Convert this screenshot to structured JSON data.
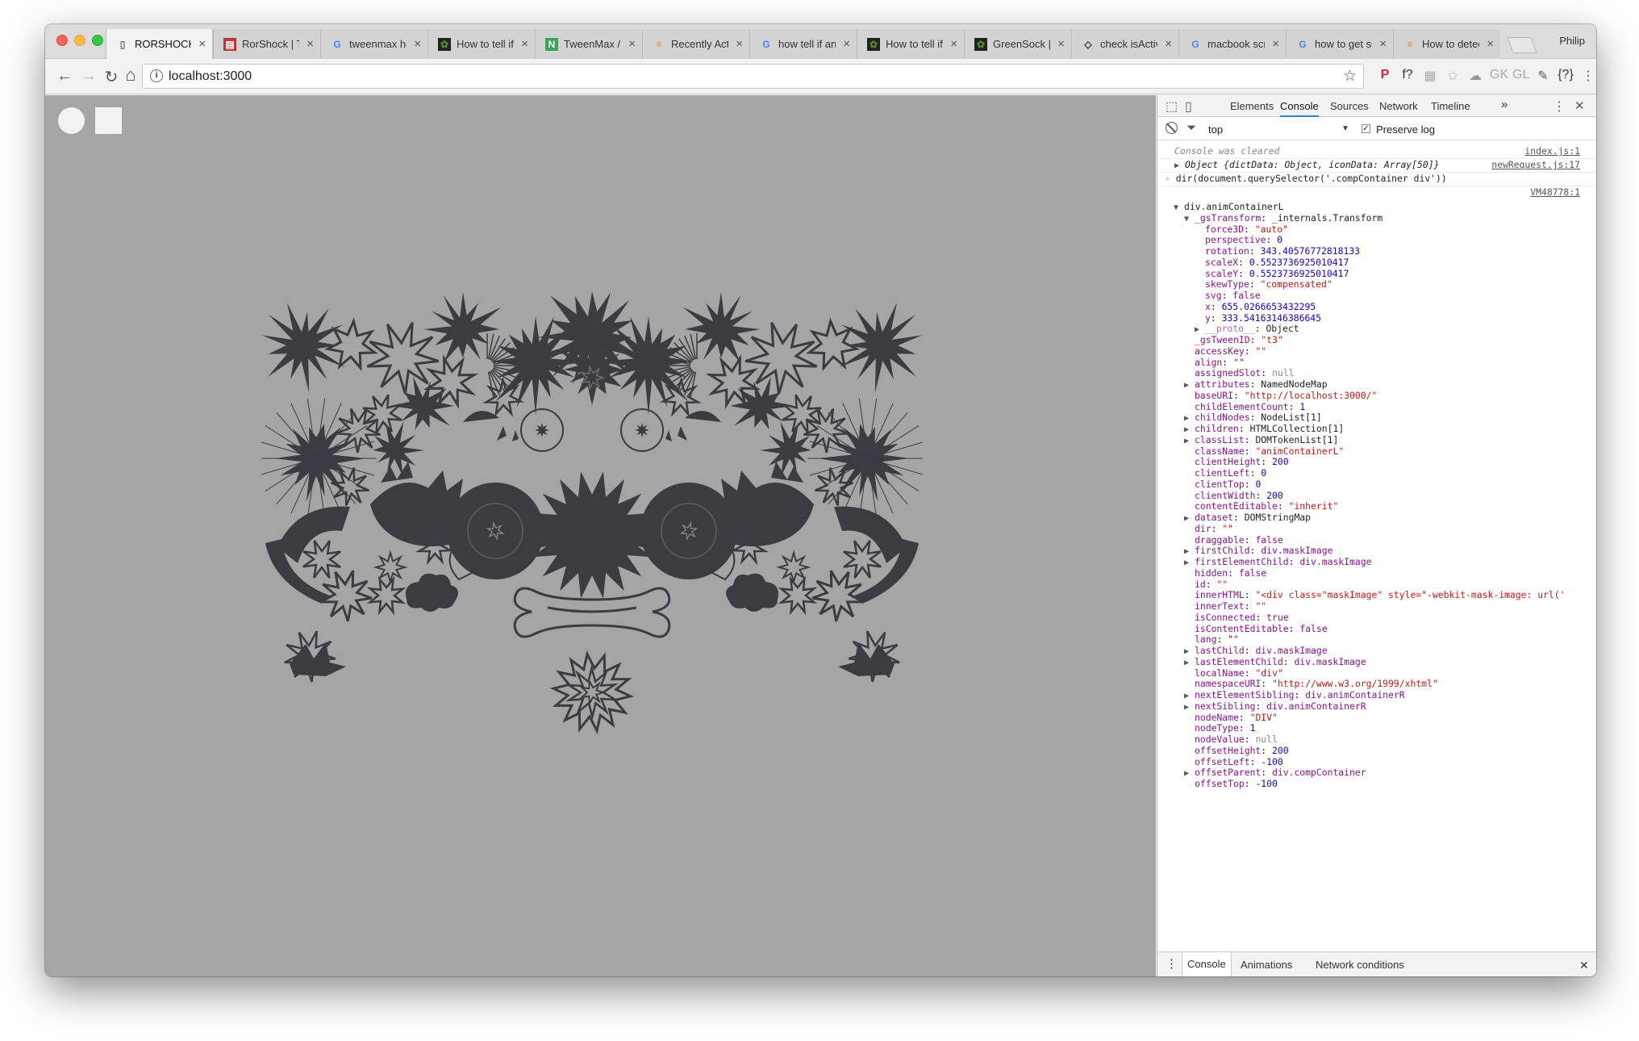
{
  "window": {
    "user_label": "Philip",
    "tabs": [
      {
        "title": "RORSHOCK",
        "icon": "page-icon",
        "active": true
      },
      {
        "title": "RorShock | Tre",
        "icon": "trello-icon"
      },
      {
        "title": "tweenmax hov",
        "icon": "google-icon"
      },
      {
        "title": "How to tell if G",
        "icon": "greensock-icon"
      },
      {
        "title": "TweenMax / G",
        "icon": "tweenmax-icon"
      },
      {
        "title": "Recently Activ",
        "icon": "stackoverflow-icon"
      },
      {
        "title": "how tell if any",
        "icon": "google-icon"
      },
      {
        "title": "How to tell if G",
        "icon": "greensock-icon"
      },
      {
        "title": "GreenSock | D",
        "icon": "greensock-icon"
      },
      {
        "title": "check isActive",
        "icon": "codepen-icon"
      },
      {
        "title": "macbook scre",
        "icon": "google-icon"
      },
      {
        "title": "how to get scr",
        "icon": "google-icon"
      },
      {
        "title": "How to detect",
        "icon": "stackoverflow-icon"
      }
    ]
  },
  "toolbar": {
    "url": "localhost:3000",
    "back_icon": "←",
    "forward_icon": "→",
    "reload_icon": "↻",
    "home_icon": "⌂",
    "star_icon": "☆",
    "extensions": [
      "P",
      "f?",
      "▦",
      "✩",
      "☁",
      "GK",
      "GL",
      "✎",
      "{?}",
      "⋮"
    ]
  },
  "devtools": {
    "tabs": [
      "Elements",
      "Console",
      "Sources",
      "Network",
      "Timeline"
    ],
    "active_tab": "Console",
    "more": "»",
    "context": "top",
    "preserve_log": "Preserve log",
    "drawer_tabs": [
      "Console",
      "Animations",
      "Network conditions"
    ],
    "header_rows": [
      {
        "text": "Console was cleared",
        "source": "index.js:1"
      },
      {
        "text": "Object {dictData: Object, iconData: Array[50]}",
        "source": "newRequest.js:17"
      },
      {
        "text": "dir(document.querySelector('.compContainer div'))",
        "source": ""
      },
      {
        "text": "",
        "source": "VM48778:1"
      }
    ],
    "tree": [
      {
        "indent": 0,
        "tri": "▼",
        "key": "div.animContainerL",
        "val": "",
        "vt": "plain"
      },
      {
        "indent": 1,
        "tri": "▼",
        "key": "_gsTransform",
        "val": "_internals.Transform",
        "vt": "plain"
      },
      {
        "indent": 2,
        "tri": "",
        "key": "force3D",
        "val": "\"auto\"",
        "vt": "str"
      },
      {
        "indent": 2,
        "tri": "",
        "key": "perspective",
        "val": "0",
        "vt": "num"
      },
      {
        "indent": 2,
        "tri": "",
        "key": "rotation",
        "val": "343.40576772818133",
        "vt": "num"
      },
      {
        "indent": 2,
        "tri": "",
        "key": "scaleX",
        "val": "0.5523736925010417",
        "vt": "num"
      },
      {
        "indent": 2,
        "tri": "",
        "key": "scaleY",
        "val": "0.5523736925010417",
        "vt": "num"
      },
      {
        "indent": 2,
        "tri": "",
        "key": "skewType",
        "val": "\"compensated\"",
        "vt": "str"
      },
      {
        "indent": 2,
        "tri": "",
        "key": "svg",
        "val": "false",
        "vt": "kw"
      },
      {
        "indent": 2,
        "tri": "",
        "key": "x",
        "val": "655.0266653432295",
        "vt": "num"
      },
      {
        "indent": 2,
        "tri": "",
        "key": "y",
        "val": "333.54163146386645",
        "vt": "num"
      },
      {
        "indent": 2,
        "tri": "▶",
        "key": "__proto__",
        "val": "Object",
        "vt": "plain",
        "dim": true
      },
      {
        "indent": 1,
        "tri": "",
        "key": "_gsTweenID",
        "val": "\"t3\"",
        "vt": "str"
      },
      {
        "indent": 1,
        "tri": "",
        "key": "accessKey",
        "val": "\"\"",
        "vt": "str"
      },
      {
        "indent": 1,
        "tri": "",
        "key": "align",
        "val": "\"\"",
        "vt": "str"
      },
      {
        "indent": 1,
        "tri": "",
        "key": "assignedSlot",
        "val": "null",
        "vt": "dim"
      },
      {
        "indent": 1,
        "tri": "▶",
        "key": "attributes",
        "val": "NamedNodeMap",
        "vt": "plain"
      },
      {
        "indent": 1,
        "tri": "",
        "key": "baseURI",
        "val": "\"http://localhost:3000/\"",
        "vt": "str"
      },
      {
        "indent": 1,
        "tri": "",
        "key": "childElementCount",
        "val": "1",
        "vt": "num"
      },
      {
        "indent": 1,
        "tri": "▶",
        "key": "childNodes",
        "val": "NodeList[1]",
        "vt": "plain"
      },
      {
        "indent": 1,
        "tri": "▶",
        "key": "children",
        "val": "HTMLCollection[1]",
        "vt": "plain"
      },
      {
        "indent": 1,
        "tri": "▶",
        "key": "classList",
        "val": "DOMTokenList[1]",
        "vt": "plain"
      },
      {
        "indent": 1,
        "tri": "",
        "key": "className",
        "val": "\"animContainerL\"",
        "vt": "str"
      },
      {
        "indent": 1,
        "tri": "",
        "key": "clientHeight",
        "val": "200",
        "vt": "num"
      },
      {
        "indent": 1,
        "tri": "",
        "key": "clientLeft",
        "val": "0",
        "vt": "num"
      },
      {
        "indent": 1,
        "tri": "",
        "key": "clientTop",
        "val": "0",
        "vt": "num"
      },
      {
        "indent": 1,
        "tri": "",
        "key": "clientWidth",
        "val": "200",
        "vt": "num"
      },
      {
        "indent": 1,
        "tri": "",
        "key": "contentEditable",
        "val": "\"inherit\"",
        "vt": "str"
      },
      {
        "indent": 1,
        "tri": "▶",
        "key": "dataset",
        "val": "DOMStringMap",
        "vt": "plain"
      },
      {
        "indent": 1,
        "tri": "",
        "key": "dir",
        "val": "\"\"",
        "vt": "str"
      },
      {
        "indent": 1,
        "tri": "",
        "key": "draggable",
        "val": "false",
        "vt": "kw"
      },
      {
        "indent": 1,
        "tri": "▶",
        "key": "firstChild",
        "val": "div.maskImage",
        "vt": "el"
      },
      {
        "indent": 1,
        "tri": "▶",
        "key": "firstElementChild",
        "val": "div.maskImage",
        "vt": "el"
      },
      {
        "indent": 1,
        "tri": "",
        "key": "hidden",
        "val": "false",
        "vt": "kw"
      },
      {
        "indent": 1,
        "tri": "",
        "key": "id",
        "val": "\"\"",
        "vt": "str"
      },
      {
        "indent": 1,
        "tri": "",
        "key": "innerHTML",
        "val": "\"<div class=\"maskImage\" style=\"-webkit-mask-image: url('",
        "vt": "str"
      },
      {
        "indent": 1,
        "tri": "",
        "key": "innerText",
        "val": "\"\"",
        "vt": "str"
      },
      {
        "indent": 1,
        "tri": "",
        "key": "isConnected",
        "val": "true",
        "vt": "kw"
      },
      {
        "indent": 1,
        "tri": "",
        "key": "isContentEditable",
        "val": "false",
        "vt": "kw"
      },
      {
        "indent": 1,
        "tri": "",
        "key": "lang",
        "val": "\"\"",
        "vt": "str"
      },
      {
        "indent": 1,
        "tri": "▶",
        "key": "lastChild",
        "val": "div.maskImage",
        "vt": "el"
      },
      {
        "indent": 1,
        "tri": "▶",
        "key": "lastElementChild",
        "val": "div.maskImage",
        "vt": "el"
      },
      {
        "indent": 1,
        "tri": "",
        "key": "localName",
        "val": "\"div\"",
        "vt": "str"
      },
      {
        "indent": 1,
        "tri": "",
        "key": "namespaceURI",
        "val": "\"http://www.w3.org/1999/xhtml\"",
        "vt": "str"
      },
      {
        "indent": 1,
        "tri": "▶",
        "key": "nextElementSibling",
        "val": "div.animContainerR",
        "vt": "el"
      },
      {
        "indent": 1,
        "tri": "▶",
        "key": "nextSibling",
        "val": "div.animContainerR",
        "vt": "el"
      },
      {
        "indent": 1,
        "tri": "",
        "key": "nodeName",
        "val": "\"DIV\"",
        "vt": "str"
      },
      {
        "indent": 1,
        "tri": "",
        "key": "nodeType",
        "val": "1",
        "vt": "num"
      },
      {
        "indent": 1,
        "tri": "",
        "key": "nodeValue",
        "val": "null",
        "vt": "dim"
      },
      {
        "indent": 1,
        "tri": "",
        "key": "offsetHeight",
        "val": "200",
        "vt": "num"
      },
      {
        "indent": 1,
        "tri": "",
        "key": "offsetLeft",
        "val": "-100",
        "vt": "num"
      },
      {
        "indent": 1,
        "tri": "▶",
        "key": "offsetParent",
        "val": "div.compContainer",
        "vt": "el"
      },
      {
        "indent": 1,
        "tri": "",
        "key": "offsetTop",
        "val": "-100",
        "vt": "num"
      }
    ]
  },
  "colors": {
    "page_bg": "#a5a5a5",
    "shape": "#3c3b42",
    "circle_button": "#f2f2f2"
  }
}
